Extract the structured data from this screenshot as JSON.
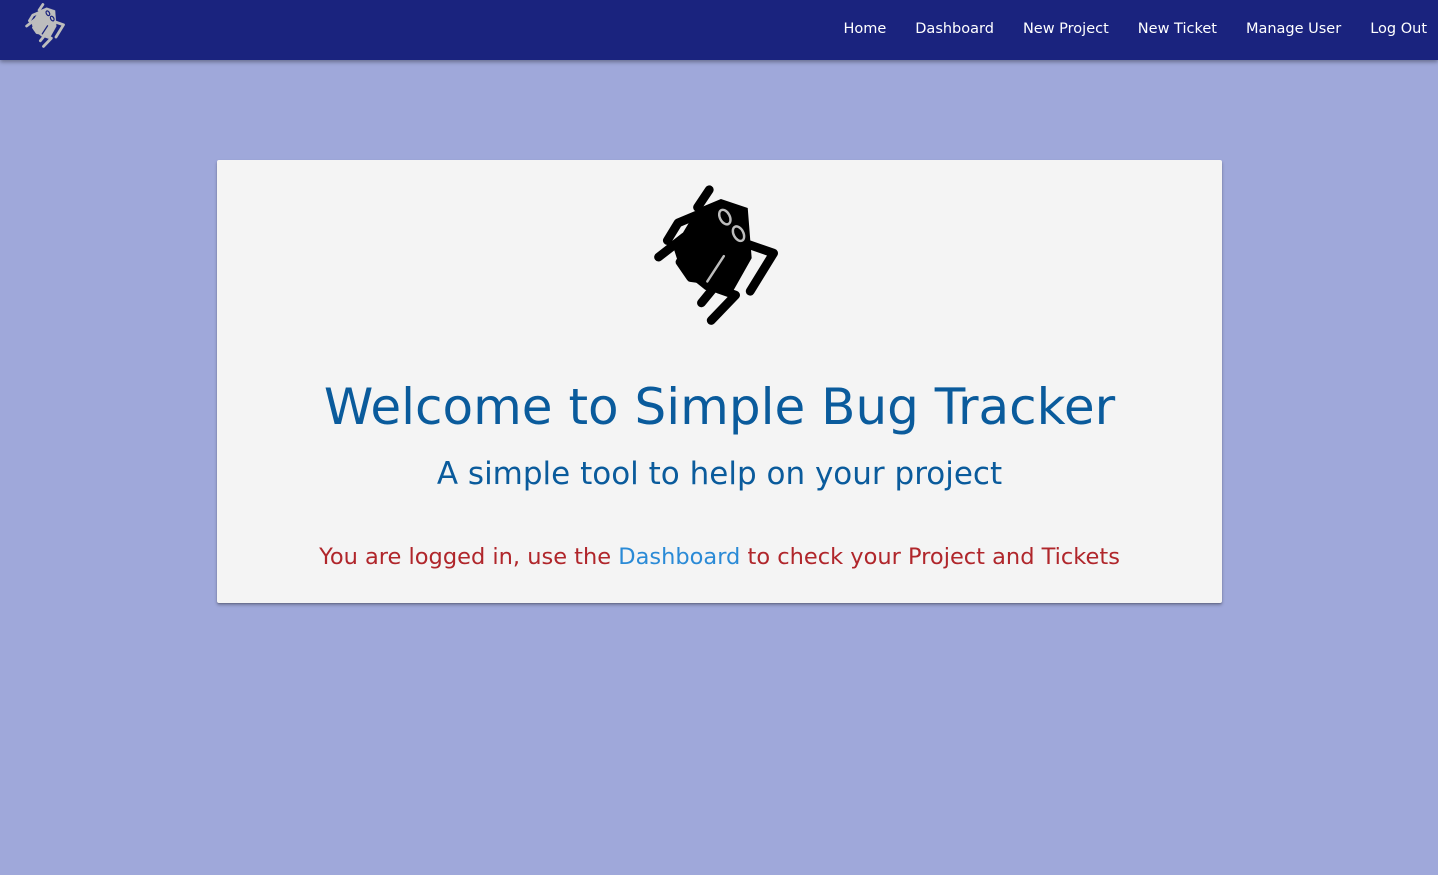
{
  "navbar": {
    "logo_icon": "bug-logo-icon",
    "links": [
      {
        "label": "Home"
      },
      {
        "label": "Dashboard"
      },
      {
        "label": "New Project"
      },
      {
        "label": "New Ticket"
      },
      {
        "label": "Manage User"
      },
      {
        "label": "Log Out"
      }
    ]
  },
  "hero": {
    "logo_icon": "bug-logo-icon",
    "title": "Welcome to Simple Bug Tracker",
    "subtitle": "A simple tool to help on your project",
    "message_prefix": "You are logged in, use the ",
    "message_link": "Dashboard",
    "message_suffix": " to check your Project and Tickets"
  },
  "colors": {
    "navbar_bg": "#1a237e",
    "page_bg": "#9fa8da",
    "card_bg": "#f4f4f4",
    "title_color": "#0a5b9c",
    "message_color": "#b0262b",
    "link_color": "#2a8ad6"
  }
}
